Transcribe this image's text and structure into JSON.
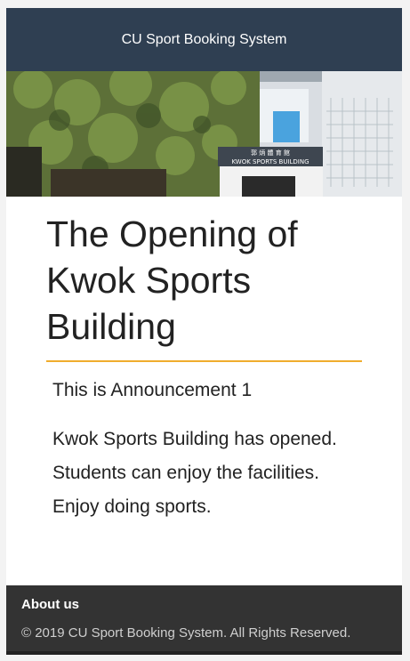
{
  "navbar": {
    "brand": "CU Sport Booking System"
  },
  "hero": {
    "sign_text": "KWOK SPORTS BUILDING",
    "sign_chinese": "郭 炳 體 育 館"
  },
  "announcement": {
    "title": "The Opening of Kwok Sports Building",
    "subtitle": "This is Announcement 1",
    "body": "Kwok Sports Building has opened. Students can enjoy the facilities. Enjoy doing sports."
  },
  "footer": {
    "about_label": "About us",
    "copyright": "© 2019 CU Sport Booking System. All Rights Reserved."
  },
  "colors": {
    "navbar_bg": "#2f3f52",
    "accent_underline": "#f0ad2e",
    "footer_bg": "#333333"
  }
}
